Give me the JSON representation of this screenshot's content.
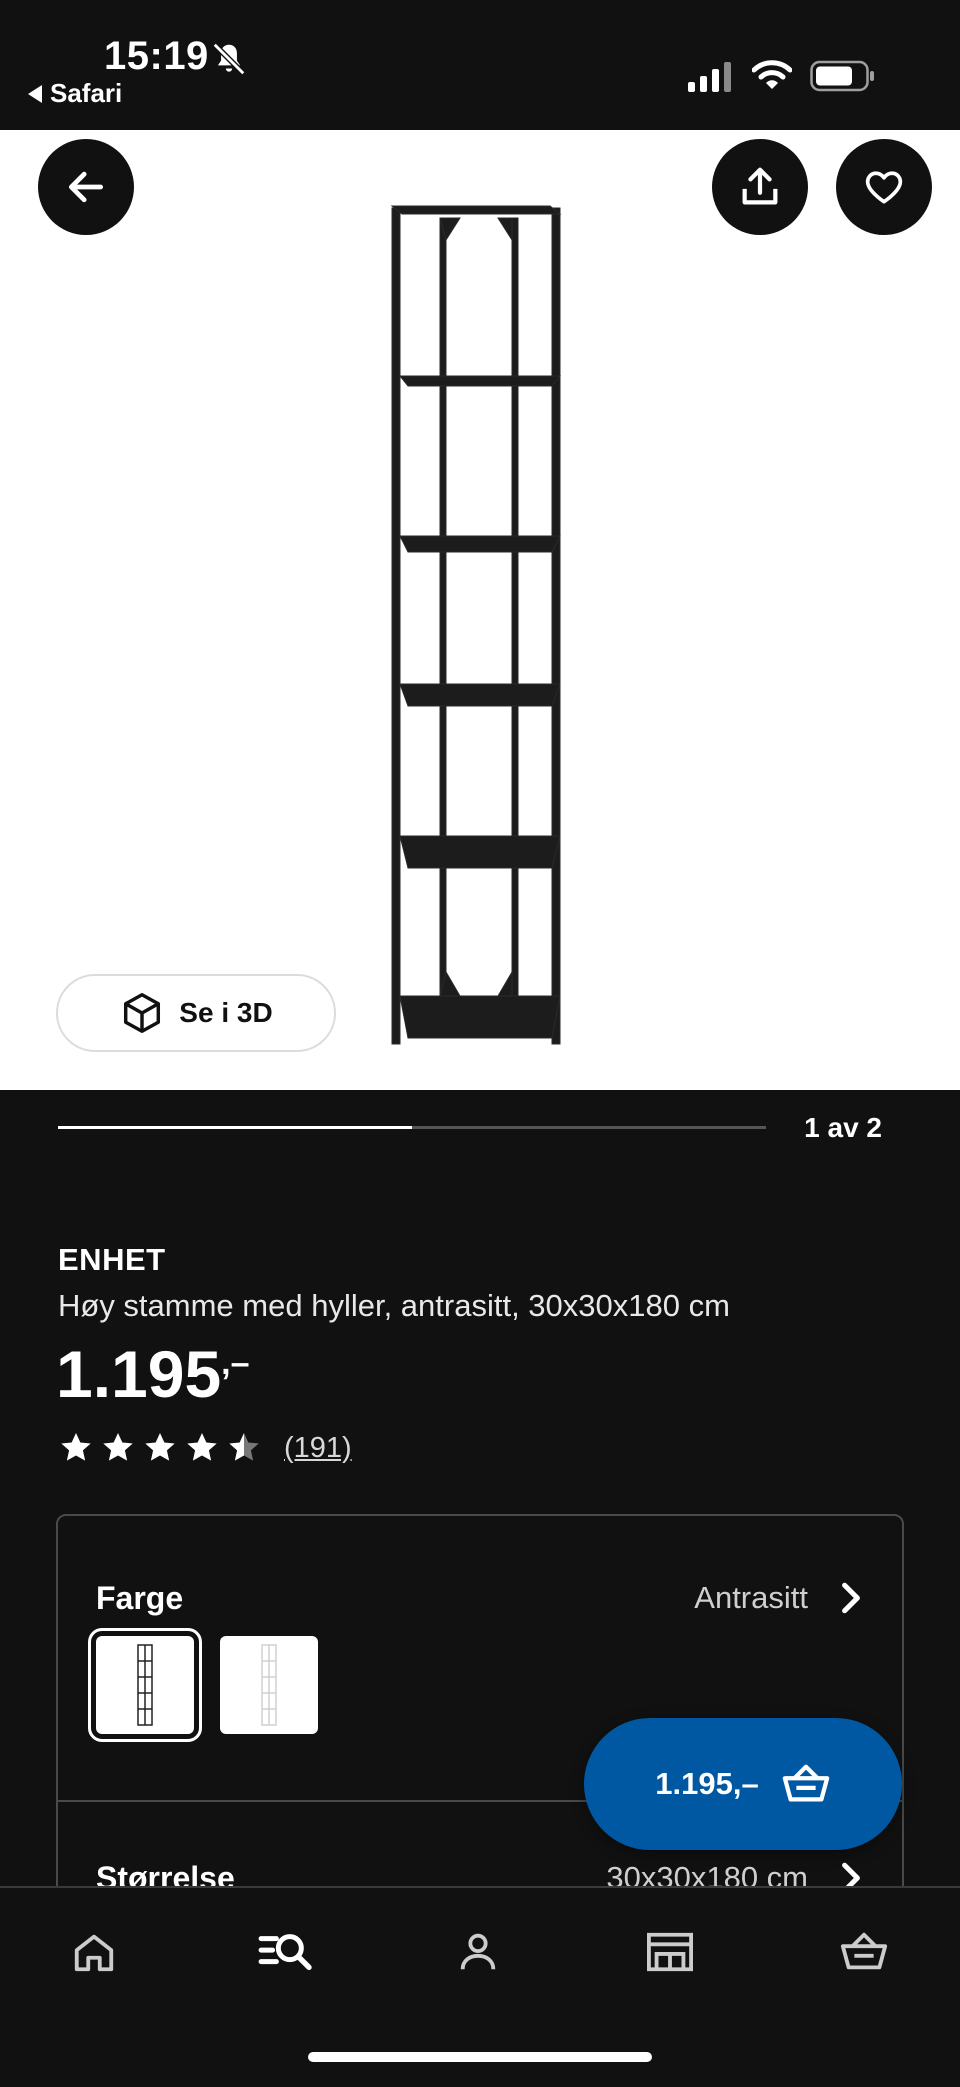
{
  "status_bar": {
    "time": "15:19",
    "back_app": "Safari",
    "icons": [
      "bell-slash-icon",
      "cellular-signal-icon",
      "wifi-icon",
      "battery-icon"
    ]
  },
  "hero": {
    "buttons": [
      "back-arrow-icon",
      "share-icon",
      "heart-icon"
    ],
    "see_3d_label": "Se i 3D",
    "image_alt": "ENHET shelving unit"
  },
  "gallery": {
    "position_label": "1 av 2",
    "progress": 0.5
  },
  "product": {
    "brand": "ENHET",
    "description": "Høy stamme med hyller, antrasitt, 30x30x180 cm",
    "price": "1.195",
    "price_suffix": ",–",
    "rating": 4.5,
    "rating_max": 5,
    "review_count": "(191)"
  },
  "options": {
    "color_label": "Farge",
    "color_value": "Antrasitt",
    "swatches": [
      "antrasitt",
      "hvit"
    ],
    "size_label": "Størrelse",
    "size_value": "30x30x180 cm"
  },
  "cart_button": {
    "label": "1.195,–",
    "accent": "#0058a3"
  },
  "bottom_nav": {
    "items": [
      "home-icon",
      "search-list-icon",
      "profile-icon",
      "store-icon",
      "basket-icon"
    ]
  }
}
